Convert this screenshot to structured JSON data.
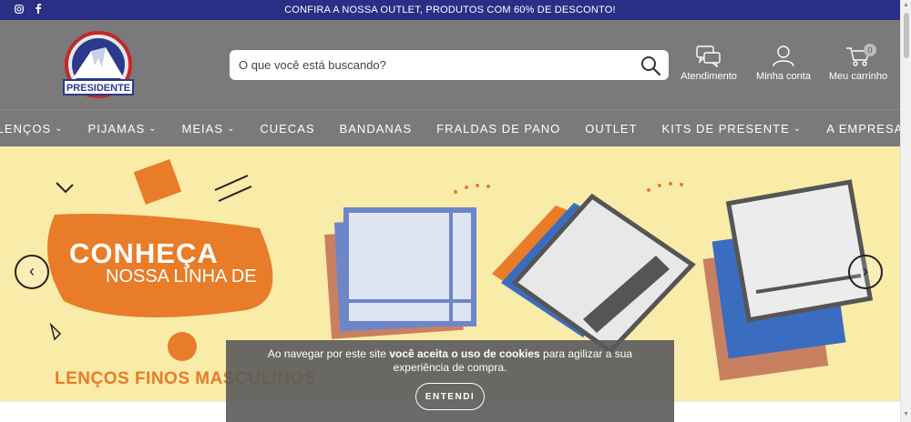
{
  "topbar": {
    "promo": "CONFIRA A NOSSA OUTLET, PRODUTOS COM 60% DE DESCONTO!",
    "instagram_icon": "instagram-icon",
    "facebook_icon": "facebook-icon"
  },
  "header": {
    "logo_text": "PRESIDENTE",
    "search_placeholder": "O que você está buscando?",
    "atendimento": "Atendimento",
    "minha_conta": "Minha conta",
    "carrinho": "Meu carrinho",
    "cart_count": "0"
  },
  "nav": {
    "items": [
      {
        "label": "LENÇOS",
        "dropdown": true
      },
      {
        "label": "PIJAMAS",
        "dropdown": true
      },
      {
        "label": "MEIAS",
        "dropdown": true
      },
      {
        "label": "CUECAS",
        "dropdown": false
      },
      {
        "label": "BANDANAS",
        "dropdown": false
      },
      {
        "label": "FRALDAS DE PANO",
        "dropdown": false
      },
      {
        "label": "OUTLET",
        "dropdown": false
      },
      {
        "label": "KITS DE PRESENTE",
        "dropdown": true
      },
      {
        "label": "A EMPRESA",
        "dropdown": false
      }
    ]
  },
  "banner": {
    "line1": "CONHEÇA",
    "line2": "NOSSA LINHA DE",
    "line3": "LENÇOS FINOS MASCULINOS",
    "prev": "‹",
    "next": "›"
  },
  "cookie": {
    "text_pre": "Ao navegar por este site ",
    "text_bold": "você aceita o uso de cookies",
    "text_post": " para agilizar a sua experiência de compra.",
    "button": "ENTENDI"
  },
  "colors": {
    "topbar": "#2a2f86",
    "header": "#7a7a7a",
    "banner": "#f9eba8",
    "accent_orange": "#e87c28"
  }
}
